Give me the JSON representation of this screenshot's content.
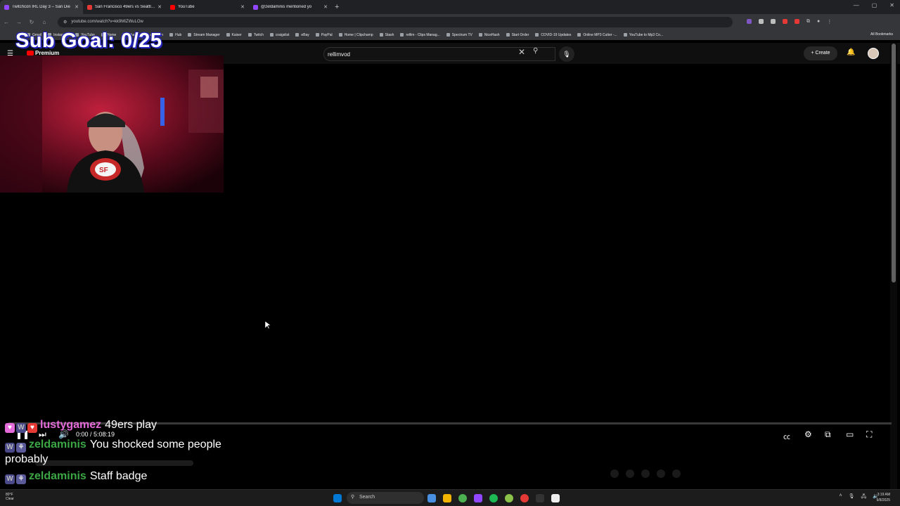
{
  "browser": {
    "tabs": [
      {
        "title": "Twitchcon IRL Day 3 – San Die",
        "color": "#9146ff",
        "active": true
      },
      {
        "title": "San Francisco 49ers vs Seattle S",
        "color": "#e53935",
        "active": false
      },
      {
        "title": "YouTube",
        "color": "#ff0000",
        "active": false
      },
      {
        "title": "@zeldaminis mentioned yo",
        "color": "#9146ff",
        "active": false
      }
    ],
    "url": "youtube.com/watch?v=kk9MIZWuLOw",
    "bookmarks": [
      "Gmail",
      "Instagram",
      "YouTube",
      "Home",
      "Chase",
      "Amazon",
      "Hub",
      "Stream Manager",
      "Kaiser",
      "Twitch",
      "craigslist",
      "eBay",
      "PayPal",
      "Home | Clipchamp",
      "Stash",
      "rellim - Clips Manag...",
      "Spectrum TV",
      "NiceHash",
      "Start Order",
      "COVID-19 Updates",
      "Online MP3 Cutter -...",
      "YouTube to Mp3 Co..."
    ],
    "all_bookmarks_label": "All Bookmarks"
  },
  "youtube": {
    "logo_text": "Premium",
    "search_value": "rellimvod",
    "create_label": "Create"
  },
  "overlay": {
    "sub_goal": "Sub Goal: 0/25"
  },
  "player": {
    "time": "0:00 / 5:08:19",
    "progress": 0
  },
  "chat": [
    {
      "user": "lustygamez",
      "user_color": "#e46ad9",
      "message": "49ers play"
    },
    {
      "user": "zeldaminis",
      "user_color": "#3ba745",
      "message": "You shocked some people probably"
    },
    {
      "user": "zeldaminis",
      "user_color": "#3ba745",
      "message": "Staff badge"
    }
  ],
  "taskbar": {
    "weather_temp": "80°F",
    "weather_desc": "Clear",
    "search_label": "Search",
    "time": "3:19 AM",
    "date": "9/8/2025"
  }
}
